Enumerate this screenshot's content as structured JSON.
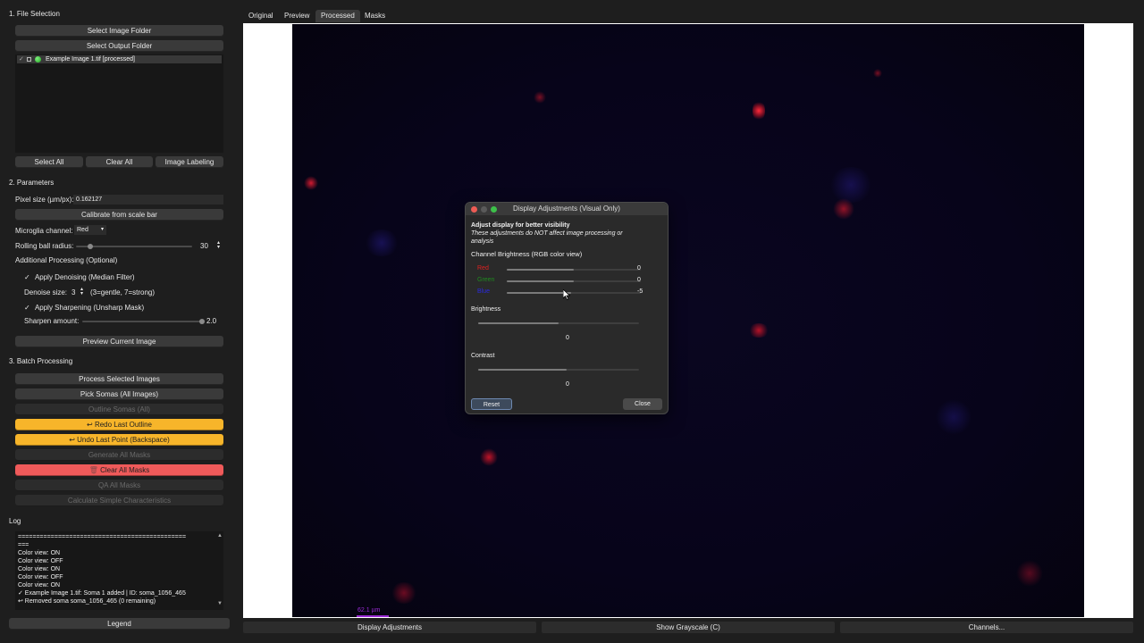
{
  "file_selection": {
    "title": "1. File Selection",
    "select_image_folder": "Select Image Folder",
    "select_output_folder": "Select Output Folder",
    "file_item": "Example Image 1.tif [processed]",
    "select_all": "Select All",
    "clear_all": "Clear All",
    "image_labeling": "Image Labeling"
  },
  "parameters": {
    "title": "2. Parameters",
    "pixel_size_label": "Pixel size (µm/px):",
    "pixel_size_value": "0.162127",
    "calibrate_button": "Calibrate from scale bar",
    "microglia_channel_label": "Microglia channel:",
    "microglia_channel_value": "Red",
    "rolling_ball_label": "Rolling ball radius:",
    "rolling_ball_value": "30",
    "rolling_ball_level": 0.12,
    "additional_processing": "Additional Processing (Optional)",
    "apply_denoising": "Apply Denoising (Median Filter)",
    "denoise_size_label": "Denoise size:",
    "denoise_size_value": "3",
    "denoise_hint": "(3=gentle, 7=strong)",
    "apply_sharpening": "Apply Sharpening (Unsharp Mask)",
    "sharpen_amount_label": "Sharpen amount:",
    "sharpen_amount_value": "2.0",
    "sharpen_level": 1.0,
    "preview_button": "Preview Current Image"
  },
  "batch": {
    "title": "3. Batch Processing",
    "process_selected": "Process Selected Images",
    "pick_somas": "Pick Somas (All Images)",
    "outline_somas": "Outline Somas (All)",
    "redo_last_outline": "↩ Redo Last Outline",
    "undo_last_point": "↩ Undo Last Point (Backspace)",
    "generate_all_masks": "Generate All Masks",
    "clear_all_masks": "Clear All Masks",
    "qa_all_masks": "QA All Masks",
    "calculate_simple": "Calculate Simple Characteristics",
    "accent_yellow": "#f7b52a",
    "accent_red": "#ef5a5a"
  },
  "log": {
    "title": "Log",
    "lines": [
      "==============================================",
      "===",
      "Color view: ON",
      "Color view: OFF",
      "Color view: ON",
      "Color view: OFF",
      "Color view: ON",
      "✓ Example Image 1.tif: Soma 1 added | ID: soma_1056_465",
      "↩ Removed soma soma_1056_465 (0 remaining)"
    ],
    "legend_button": "Legend"
  },
  "tabs": [
    "Original",
    "Preview",
    "Processed",
    "Masks"
  ],
  "active_tab": "Processed",
  "viewer": {
    "scale_bar_label": "62.1 µm"
  },
  "bottom_bar": {
    "display_adjustments": "Display Adjustments",
    "show_grayscale": "Show Grayscale (C)",
    "channels": "Channels..."
  },
  "dialog": {
    "title": "Display Adjustments (Visual Only)",
    "heading": "Adjust display for better visibility",
    "note_line1": "These adjustments do NOT affect image processing or",
    "note_line2": "analysis",
    "channel_brightness_label": "Channel Brightness (RGB color view)",
    "channels": [
      {
        "name": "Red",
        "value": "0",
        "color": "#e02020",
        "level": 0.5
      },
      {
        "name": "Green",
        "value": "0",
        "color": "#1f8a1f",
        "level": 0.5
      },
      {
        "name": "Blue",
        "value": "-5",
        "color": "#2a2ae0",
        "level": 0.48
      }
    ],
    "brightness_label": "Brightness",
    "brightness_value": "0",
    "brightness_level": 0.5,
    "contrast_label": "Contrast",
    "contrast_value": "0",
    "contrast_level": 0.55,
    "reset_button": "Reset",
    "close_button": "Close"
  }
}
